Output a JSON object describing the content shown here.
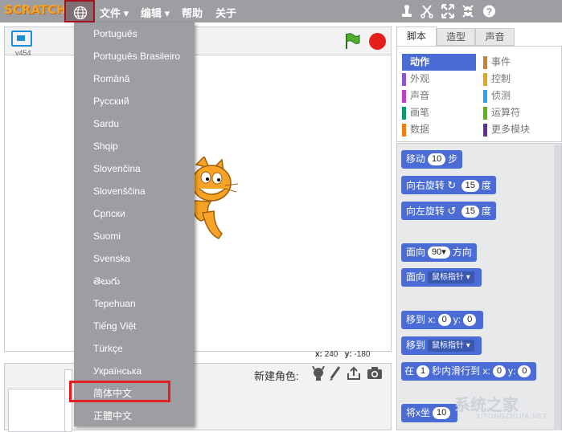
{
  "app": {
    "logo_text": "SCRATCH",
    "version": "v454"
  },
  "menubar": {
    "items": [
      {
        "label": "文件 ▾"
      },
      {
        "label": "编辑 ▾"
      },
      {
        "label": "帮助"
      },
      {
        "label": "关于"
      }
    ],
    "tool_icons": [
      "duplicate-stamp-icon",
      "delete-cut-icon",
      "grow-icon",
      "shrink-icon",
      "help-icon"
    ]
  },
  "stage": {
    "coords": {
      "x_label": "x:",
      "x_value": "240",
      "y_label": "y:",
      "y_value": "-180"
    }
  },
  "sprites": {
    "new_sprite_label": "新建角色:",
    "actions": [
      "choose-sprite-icon",
      "paint-sprite-icon",
      "upload-sprite-icon",
      "camera-sprite-icon"
    ]
  },
  "tabs": [
    {
      "label": "脚本"
    },
    {
      "label": "造型"
    },
    {
      "label": "声音"
    }
  ],
  "categories": {
    "left": [
      {
        "label": "动作",
        "color": "#4a6cd4",
        "selected": true
      },
      {
        "label": "外观",
        "color": "#8a55d7"
      },
      {
        "label": "声音",
        "color": "#bb42c3"
      },
      {
        "label": "画笔",
        "color": "#0e9a6c"
      },
      {
        "label": "数据",
        "color": "#ee7d16"
      }
    ],
    "right": [
      {
        "label": "事件",
        "color": "#c88330"
      },
      {
        "label": "控制",
        "color": "#e1a91a"
      },
      {
        "label": "侦测",
        "color": "#2ca5e2"
      },
      {
        "label": "运算符",
        "color": "#5cb712"
      },
      {
        "label": "更多模块",
        "color": "#632d99"
      }
    ]
  },
  "blocks": {
    "move": {
      "label": "移动",
      "value": "10",
      "suffix": "步"
    },
    "turn_right": {
      "label": "向右旋转",
      "value": "15",
      "suffix": "度"
    },
    "turn_left": {
      "label": "向左旋转",
      "value": "15",
      "suffix": "度"
    },
    "point_direction": {
      "label": "面向",
      "value": "90▾",
      "suffix": "方向"
    },
    "point_towards": {
      "label": "面向",
      "dropdown": "鼠标指针 ▾"
    },
    "goto_xy": {
      "label": "移到 x:",
      "x": "0",
      "y_label": "y:",
      "y": "0"
    },
    "goto": {
      "label": "移到",
      "dropdown": "鼠标指针 ▾"
    },
    "glide": {
      "label": "在",
      "secs": "1",
      "mid": "秒内滑行到 x:",
      "x": "0",
      "y_label": "y:",
      "y": "0"
    },
    "change_x": {
      "label": "将x坐",
      "value": "10"
    }
  },
  "language_menu": {
    "items": [
      "Português",
      "Português Brasileiro",
      "Română",
      "Русский",
      "Sardu",
      "Shqip",
      "Slovenčina",
      "Slovenščina",
      "Српски",
      "Suomi",
      "Svenska",
      "తెలుగు",
      "Tepehuan",
      "Tiếng Việt",
      "Türkçe",
      "Українська",
      "简体中文",
      "正體中文"
    ],
    "highlighted": "简体中文"
  },
  "watermark": {
    "text": "系统之家",
    "sub": "XITONGZHIJIA.NET"
  }
}
